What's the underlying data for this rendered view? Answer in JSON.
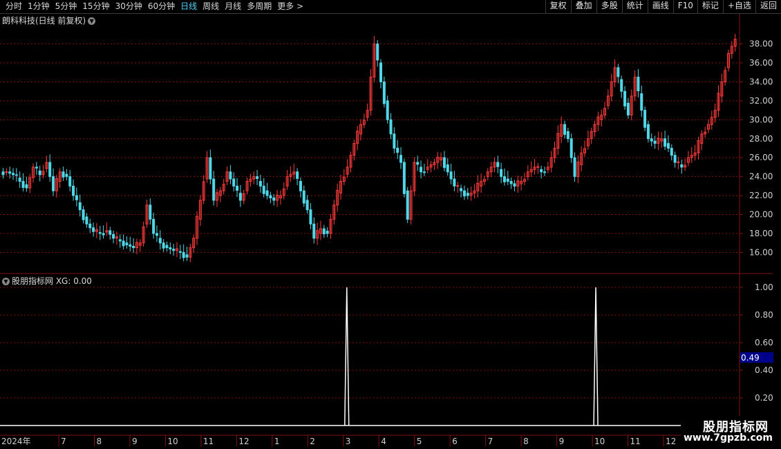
{
  "toolbar": {
    "periods": [
      "分时",
      "1分钟",
      "5分钟",
      "15分钟",
      "30分钟",
      "60分钟",
      "日线",
      "周线",
      "月线",
      "多周期",
      "更多 >"
    ],
    "active_index": 6,
    "buttons": [
      "复权",
      "叠加",
      "多股",
      "统计",
      "画线",
      "F10",
      "标记",
      "+自选",
      "返回"
    ]
  },
  "stock": {
    "title": "朗科科技(日线 前复权)"
  },
  "indicator": {
    "title": "股朋指标网  XG: 0.00",
    "cursor_value": "0.49"
  },
  "time_axis": {
    "year_label": "2024年",
    "months": [
      "7",
      "8",
      "9",
      "10",
      "11",
      "12",
      "1",
      "2",
      "3",
      "4",
      "5",
      "6",
      "7",
      "8",
      "9",
      "10",
      "11",
      "12"
    ]
  },
  "watermark": {
    "name": "股朋指标网",
    "url": "www.7gpzb.com"
  },
  "colors": {
    "up": "#ff3b3b",
    "down": "#50d8e8",
    "grid": "#8a1010",
    "signal": "#ffffff",
    "axis_bg": "#00008a"
  },
  "chart_data": [
    {
      "type": "candlestick",
      "y_ticks": [
        "16.00",
        "18.00",
        "20.00",
        "22.00",
        "24.00",
        "26.00",
        "28.00",
        "30.00",
        "32.00",
        "34.00",
        "36.00",
        "38.00"
      ],
      "ylim": [
        14.5,
        39.5
      ],
      "series_close_approx": [
        24.5,
        24.2,
        23.5,
        22.8,
        25.0,
        24.2,
        25.5,
        22.5,
        24.5,
        24.0,
        22.0,
        20.5,
        19.0,
        18.2,
        18.0,
        18.3,
        17.5,
        17.2,
        16.8,
        16.5,
        17.0,
        21.0,
        18.0,
        17.0,
        16.5,
        16.2,
        16.0,
        15.5,
        17.5,
        21.5,
        26.0,
        21.5,
        22.5,
        24.5,
        23.0,
        21.5,
        23.5,
        24.0,
        23.0,
        22.0,
        21.5,
        22.0,
        24.0,
        24.5,
        22.5,
        20.5,
        17.5,
        18.5,
        18.0,
        21.0,
        23.5,
        25.0,
        27.5,
        29.5,
        31.0,
        38.0,
        34.0,
        30.0,
        27.0,
        25.5,
        19.5,
        25.5,
        24.5,
        25.0,
        25.5,
        26.0,
        24.5,
        23.0,
        22.5,
        22.0,
        22.5,
        23.5,
        24.5,
        25.5,
        24.0,
        23.5,
        23.0,
        23.5,
        24.5,
        25.0,
        24.5,
        25.0,
        27.0,
        29.5,
        28.0,
        24.0,
        26.5,
        28.0,
        29.5,
        30.5,
        32.5,
        35.5,
        33.0,
        30.5,
        34.5,
        31.0,
        28.0,
        27.5,
        28.0,
        27.0,
        25.5,
        25.0,
        26.0,
        26.5,
        28.5,
        29.5,
        31.0,
        34.0,
        37.0,
        38.5
      ]
    },
    {
      "type": "bar",
      "y_ticks": [
        "0.20",
        "0.40",
        "0.60",
        "0.80",
        "1.00"
      ],
      "ylim": [
        0,
        1.0
      ],
      "signals": [
        {
          "month_index": 8,
          "value": 1.0
        },
        {
          "month_index": 15,
          "value": 1.0
        }
      ]
    }
  ]
}
